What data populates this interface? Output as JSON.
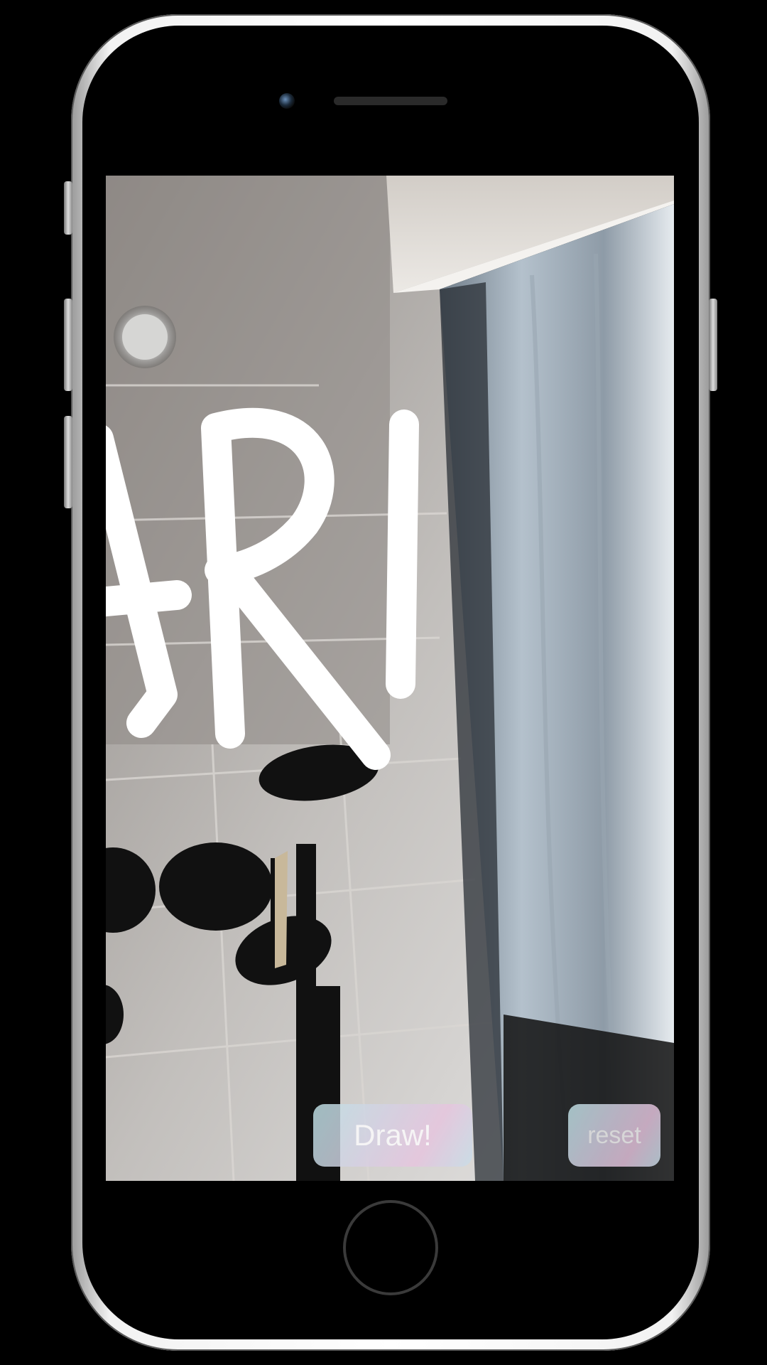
{
  "ar_drawing_app": {
    "drawn_text": "ARI",
    "buttons": {
      "draw_label": "Draw!",
      "reset_label": "reset"
    }
  },
  "colors": {
    "stroke": "#ffffff",
    "button_gradient_start": "#bfe3e8",
    "button_gradient_end": "#e7c5df",
    "device_frame": "#f2f2f2"
  },
  "icons": [
    "front-camera-icon",
    "earpiece-icon",
    "home-button-icon"
  ]
}
